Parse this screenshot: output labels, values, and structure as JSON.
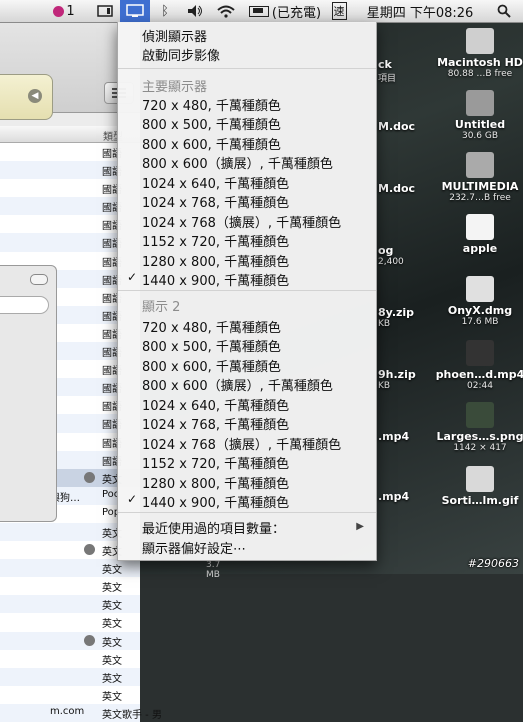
{
  "menubar": {
    "badge_count": "1",
    "clock": "星期四 下午08:26",
    "battery_status": "(已充電)",
    "input_method": "速"
  },
  "menu": {
    "detect": "偵測顯示器",
    "mirror": "啟動同步影像",
    "main_header": "主要顯示器",
    "main_modes": [
      "720 x 480, 千萬種顏色",
      "800 x 500, 千萬種顏色",
      "800 x 600, 千萬種顏色",
      "800 x 600（擴展）, 千萬種顏色",
      "1024 x 640, 千萬種顏色",
      "1024 x 768, 千萬種顏色",
      "1024 x 768（擴展）, 千萬種顏色",
      "1152 x 720, 千萬種顏色",
      "1280 x 800, 千萬種顏色",
      "1440 x 900, 千萬種顏色"
    ],
    "display2_header": "顯示 2",
    "display2_modes": [
      "720 x 480, 千萬種顏色",
      "800 x 500, 千萬種顏色",
      "800 x 600, 千萬種顏色",
      "800 x 600（擴展）, 千萬種顏色",
      "1024 x 640, 千萬種顏色",
      "1024 x 768, 千萬種顏色",
      "1024 x 768（擴展）, 千萬種顏色",
      "1152 x 720, 千萬種顏色",
      "1280 x 800, 千萬種顏色",
      "1440 x 900, 千萬種顏色"
    ],
    "recent_items": "最近使用過的項目數量：",
    "prefs": "顯示器偏好設定⋯",
    "check_mark": "✓"
  },
  "finder": {
    "col_kind": "類型",
    "rows": [
      {
        "name": "",
        "kind": "國語"
      },
      {
        "name": "",
        "kind": "國語"
      },
      {
        "name": "",
        "kind": "國語"
      },
      {
        "name": "",
        "kind": "國語"
      },
      {
        "name": "",
        "kind": "國語"
      },
      {
        "name": "",
        "kind": "國語"
      },
      {
        "name": "",
        "kind": "國語"
      },
      {
        "name": "",
        "kind": "國語"
      },
      {
        "name": "",
        "kind": "國語"
      },
      {
        "name": "",
        "kind": "國語"
      },
      {
        "name": "",
        "kind": "國語"
      },
      {
        "name": "",
        "kind": "國語"
      },
      {
        "name": "",
        "kind": "國語"
      },
      {
        "name": "",
        "kind": "國語"
      },
      {
        "name": "",
        "kind": "國語"
      },
      {
        "name": "",
        "kind": "國語"
      },
      {
        "name": "",
        "kind": "國語"
      },
      {
        "name": "",
        "kind": "國語"
      },
      {
        "name": "",
        "kind": "英文"
      },
      {
        "name": "與狗…",
        "kind": "Poc"
      },
      {
        "name": "",
        "kind": "Pop"
      },
      {
        "name": "",
        "kind": "英文"
      },
      {
        "name": "",
        "kind": "英文"
      },
      {
        "name": "",
        "kind": "英文"
      },
      {
        "name": "",
        "kind": "英文"
      },
      {
        "name": "",
        "kind": "英文"
      },
      {
        "name": "",
        "kind": "英文"
      },
      {
        "name": "",
        "kind": "英文"
      },
      {
        "name": "",
        "kind": "英文"
      },
      {
        "name": "",
        "kind": "英文"
      },
      {
        "name": "",
        "kind": "英文"
      },
      {
        "name": "m.com",
        "kind": "英文歌手 - 男"
      }
    ],
    "bottom_size": "3.7 MB"
  },
  "desktop": {
    "items": [
      {
        "label": "Macintosh HD",
        "sub": "80.88 …B free"
      },
      {
        "label": "Untitled",
        "sub": "30.6 GB"
      },
      {
        "label": "MULTIMEDIA",
        "sub": "232.7…B free"
      },
      {
        "label": "apple",
        "sub": ""
      },
      {
        "label": "OnyX.dmg",
        "sub": "17.6 MB"
      },
      {
        "label": "phoen…d.mp4",
        "sub": "02:44"
      },
      {
        "label": "Larges…s.png",
        "sub": "1142 × 417"
      },
      {
        "label": "Sorti…lm.gif",
        "sub": ""
      }
    ],
    "partial": [
      {
        "label": "ck",
        "sub": "項目"
      },
      {
        "label": "M.doc",
        "sub": ""
      },
      {
        "label": "M.doc",
        "sub": ""
      },
      {
        "label": "og",
        "sub": "2,400"
      },
      {
        "label": "8y.zip",
        "sub": "KB"
      },
      {
        "label": "9h.zip",
        "sub": "KB"
      },
      {
        "label": ".mp4",
        "sub": ""
      },
      {
        "label": ".mp4",
        "sub": ""
      }
    ]
  },
  "watermark": "#290663"
}
